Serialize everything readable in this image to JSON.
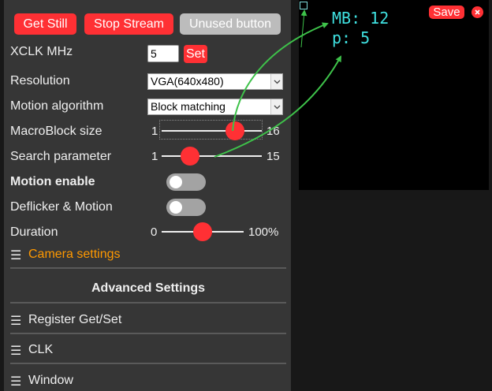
{
  "toolbar": {
    "get_still": "Get Still",
    "stop_stream": "Stop Stream",
    "unused": "Unused button"
  },
  "xclk": {
    "label": "XCLK MHz",
    "value": "5",
    "set_label": "Set"
  },
  "resolution": {
    "label": "Resolution",
    "value": "VGA(640x480)"
  },
  "motion_algorithm": {
    "label": "Motion algorithm",
    "value": "Block matching"
  },
  "macroblock": {
    "label": "MacroBlock size",
    "min": "1",
    "max": "16",
    "value": 12
  },
  "search_param": {
    "label": "Search parameter",
    "min": "1",
    "max": "15",
    "value": 5
  },
  "motion_enable": {
    "label": "Motion enable",
    "on": false
  },
  "deflicker": {
    "label": "Deflicker & Motion",
    "on": false
  },
  "duration": {
    "label": "Duration",
    "min": "0",
    "max": "100%",
    "fraction": 0.5
  },
  "sections": {
    "camera_settings": "Camera settings",
    "advanced_title": "Advanced Settings",
    "register": "Register Get/Set",
    "clk": "CLK",
    "window": "Window"
  },
  "preview": {
    "line1": "MB: 12",
    "line2": "p: 5",
    "save_label": "Save"
  },
  "colors": {
    "accent_red": "#ff3034",
    "section_orange": "#ff9900",
    "overlay_cyan": "#3fe0e0",
    "arrow_green": "#3ec24a"
  },
  "icons": {
    "hamburger": "☰",
    "close": "close-icon",
    "caret": "chevron-down-icon"
  }
}
